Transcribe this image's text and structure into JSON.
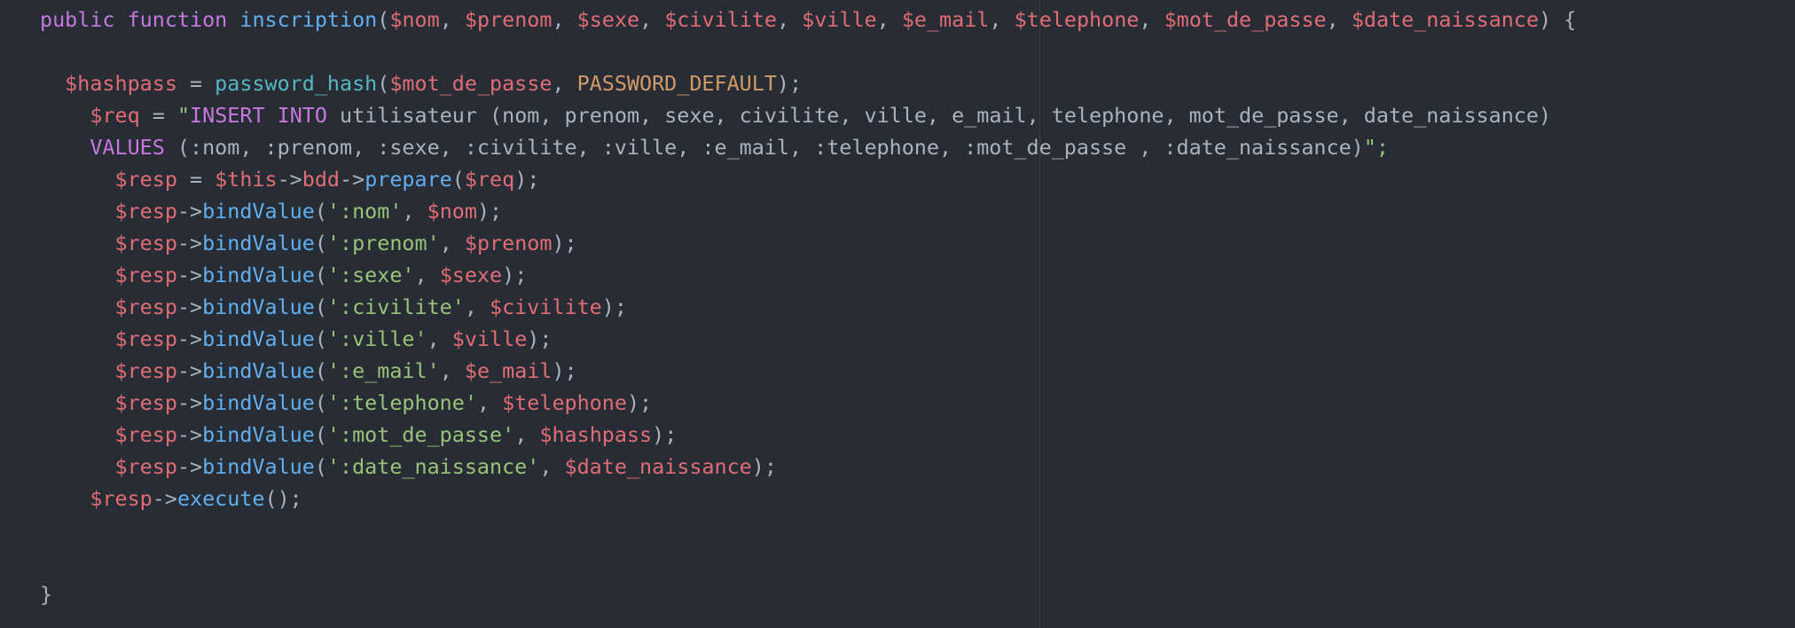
{
  "colors": {
    "background": "#282c34",
    "keyword": "#c678dd",
    "function": "#61afef",
    "variable": "#e06c75",
    "string": "#98c379",
    "constant": "#d19a66",
    "builtin": "#56b6c2",
    "text": "#abb2bf"
  },
  "code": {
    "lines": [
      {
        "tokens": [
          {
            "t": "public",
            "c": "kw"
          },
          {
            "t": " "
          },
          {
            "t": "function",
            "c": "kw"
          },
          {
            "t": " "
          },
          {
            "t": "inscription",
            "c": "fn"
          },
          {
            "t": "("
          },
          {
            "t": "$nom",
            "c": "var"
          },
          {
            "t": ", "
          },
          {
            "t": "$prenom",
            "c": "var"
          },
          {
            "t": ", "
          },
          {
            "t": "$sexe",
            "c": "var"
          },
          {
            "t": ", "
          },
          {
            "t": "$civilite",
            "c": "var"
          },
          {
            "t": ", "
          },
          {
            "t": "$ville",
            "c": "var"
          },
          {
            "t": ", "
          },
          {
            "t": "$e_mail",
            "c": "var"
          },
          {
            "t": ", "
          },
          {
            "t": "$telephone",
            "c": "var"
          },
          {
            "t": ", "
          },
          {
            "t": "$mot_de_passe",
            "c": "var"
          },
          {
            "t": ", "
          },
          {
            "t": "$date_naissance",
            "c": "var"
          },
          {
            "t": ") {"
          }
        ]
      },
      {
        "tokens": []
      },
      {
        "tokens": [
          {
            "t": "  "
          },
          {
            "t": "$hashpass",
            "c": "var"
          },
          {
            "t": " = "
          },
          {
            "t": "password_hash",
            "c": "builtin"
          },
          {
            "t": "("
          },
          {
            "t": "$mot_de_passe",
            "c": "var"
          },
          {
            "t": ", "
          },
          {
            "t": "PASSWORD_DEFAULT",
            "c": "const"
          },
          {
            "t": ");"
          }
        ]
      },
      {
        "tokens": [
          {
            "t": "    "
          },
          {
            "t": "$req",
            "c": "var"
          },
          {
            "t": " = "
          },
          {
            "t": "\"",
            "c": "str"
          },
          {
            "t": "INSERT",
            "c": "kw"
          },
          {
            "t": " "
          },
          {
            "t": "INTO",
            "c": "kw"
          },
          {
            "t": " utilisateur (nom, prenom, sexe, civilite, ville, e_mail, telephone, mot_de_passe, date_naissance)"
          }
        ]
      },
      {
        "tokens": [
          {
            "t": "    "
          },
          {
            "t": "VALUES",
            "c": "kw"
          },
          {
            "t": " (:nom, :prenom, :sexe, :civilite, :ville, :e_mail, :telephone, :mot_de_passe , :date_naissance)"
          },
          {
            "t": "\";",
            "c": "str"
          }
        ]
      },
      {
        "tokens": [
          {
            "t": "      "
          },
          {
            "t": "$resp",
            "c": "var"
          },
          {
            "t": " = "
          },
          {
            "t": "$this",
            "c": "var"
          },
          {
            "t": "->"
          },
          {
            "t": "bdd",
            "c": "var"
          },
          {
            "t": "->"
          },
          {
            "t": "prepare",
            "c": "fn"
          },
          {
            "t": "("
          },
          {
            "t": "$req",
            "c": "var"
          },
          {
            "t": ");"
          }
        ]
      },
      {
        "tokens": [
          {
            "t": "      "
          },
          {
            "t": "$resp",
            "c": "var"
          },
          {
            "t": "->"
          },
          {
            "t": "bindValue",
            "c": "fn"
          },
          {
            "t": "("
          },
          {
            "t": "':nom'",
            "c": "str"
          },
          {
            "t": ", "
          },
          {
            "t": "$nom",
            "c": "var"
          },
          {
            "t": ");"
          }
        ]
      },
      {
        "tokens": [
          {
            "t": "      "
          },
          {
            "t": "$resp",
            "c": "var"
          },
          {
            "t": "->"
          },
          {
            "t": "bindValue",
            "c": "fn"
          },
          {
            "t": "("
          },
          {
            "t": "':prenom'",
            "c": "str"
          },
          {
            "t": ", "
          },
          {
            "t": "$prenom",
            "c": "var"
          },
          {
            "t": ");"
          }
        ]
      },
      {
        "tokens": [
          {
            "t": "      "
          },
          {
            "t": "$resp",
            "c": "var"
          },
          {
            "t": "->"
          },
          {
            "t": "bindValue",
            "c": "fn"
          },
          {
            "t": "("
          },
          {
            "t": "':sexe'",
            "c": "str"
          },
          {
            "t": ", "
          },
          {
            "t": "$sexe",
            "c": "var"
          },
          {
            "t": ");"
          }
        ]
      },
      {
        "tokens": [
          {
            "t": "      "
          },
          {
            "t": "$resp",
            "c": "var"
          },
          {
            "t": "->"
          },
          {
            "t": "bindValue",
            "c": "fn"
          },
          {
            "t": "("
          },
          {
            "t": "':civilite'",
            "c": "str"
          },
          {
            "t": ", "
          },
          {
            "t": "$civilite",
            "c": "var"
          },
          {
            "t": ");"
          }
        ]
      },
      {
        "tokens": [
          {
            "t": "      "
          },
          {
            "t": "$resp",
            "c": "var"
          },
          {
            "t": "->"
          },
          {
            "t": "bindValue",
            "c": "fn"
          },
          {
            "t": "("
          },
          {
            "t": "':ville'",
            "c": "str"
          },
          {
            "t": ", "
          },
          {
            "t": "$ville",
            "c": "var"
          },
          {
            "t": ");"
          }
        ]
      },
      {
        "tokens": [
          {
            "t": "      "
          },
          {
            "t": "$resp",
            "c": "var"
          },
          {
            "t": "->"
          },
          {
            "t": "bindValue",
            "c": "fn"
          },
          {
            "t": "("
          },
          {
            "t": "':e_mail'",
            "c": "str"
          },
          {
            "t": ", "
          },
          {
            "t": "$e_mail",
            "c": "var"
          },
          {
            "t": ");"
          }
        ]
      },
      {
        "tokens": [
          {
            "t": "      "
          },
          {
            "t": "$resp",
            "c": "var"
          },
          {
            "t": "->"
          },
          {
            "t": "bindValue",
            "c": "fn"
          },
          {
            "t": "("
          },
          {
            "t": "':telephone'",
            "c": "str"
          },
          {
            "t": ", "
          },
          {
            "t": "$telephone",
            "c": "var"
          },
          {
            "t": ");"
          }
        ]
      },
      {
        "tokens": [
          {
            "t": "      "
          },
          {
            "t": "$resp",
            "c": "var"
          },
          {
            "t": "->"
          },
          {
            "t": "bindValue",
            "c": "fn"
          },
          {
            "t": "("
          },
          {
            "t": "':mot_de_passe'",
            "c": "str"
          },
          {
            "t": ", "
          },
          {
            "t": "$hashpass",
            "c": "var"
          },
          {
            "t": ");"
          }
        ]
      },
      {
        "tokens": [
          {
            "t": "      "
          },
          {
            "t": "$resp",
            "c": "var"
          },
          {
            "t": "->"
          },
          {
            "t": "bindValue",
            "c": "fn"
          },
          {
            "t": "("
          },
          {
            "t": "':date_naissance'",
            "c": "str"
          },
          {
            "t": ", "
          },
          {
            "t": "$date_naissance",
            "c": "var"
          },
          {
            "t": ");"
          }
        ]
      },
      {
        "tokens": [
          {
            "t": "    "
          },
          {
            "t": "$resp",
            "c": "var"
          },
          {
            "t": "->"
          },
          {
            "t": "execute",
            "c": "fn"
          },
          {
            "t": "();"
          }
        ]
      },
      {
        "tokens": []
      },
      {
        "tokens": []
      },
      {
        "tokens": [
          {
            "t": "}"
          }
        ]
      }
    ]
  }
}
